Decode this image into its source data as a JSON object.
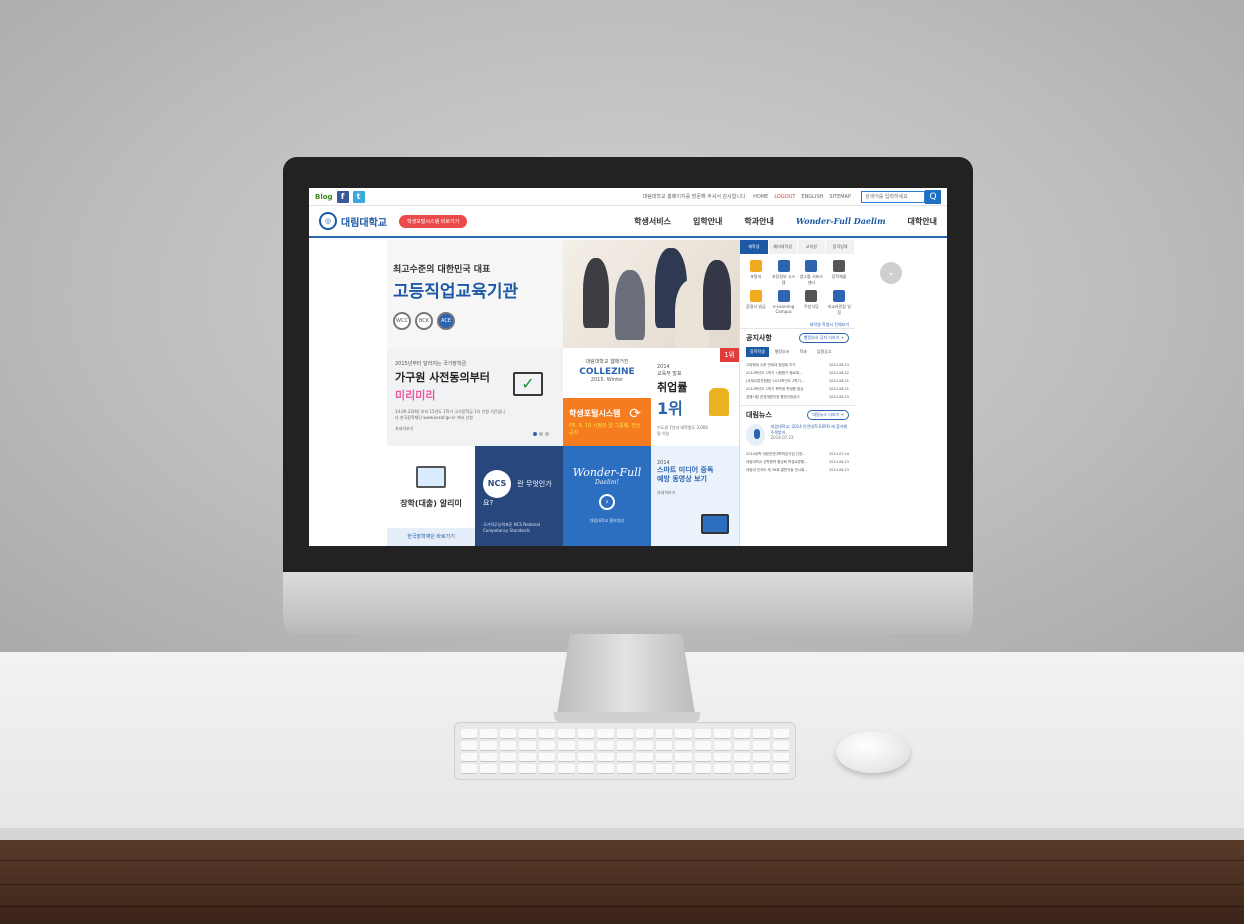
{
  "topbar": {
    "blog_label": "Blog",
    "facebook_icon": "f",
    "twitter_icon": "t",
    "notice_text": "대림대학교 홈페이지를 방문해 주셔서 감사합니다.",
    "links": [
      "HOME",
      "LOGOUT",
      "ENGLISH",
      "SITEMAP"
    ],
    "search_placeholder": "검색어를 입력하세요",
    "search_button": "Q"
  },
  "nav": {
    "logo_text": "대림대학교",
    "portal_button": "학생포털시스템 바로가기",
    "items": [
      "학생서비스",
      "입학안내",
      "학과안내",
      "Wonder-Full Daelim",
      "대학안내"
    ]
  },
  "hero": {
    "subtitle": "최고수준의 대한민국 대표",
    "title": "고등직업교육기관",
    "badges": [
      "WCC",
      "BCK",
      "ACE"
    ]
  },
  "tiles": {
    "scholarship_top": "2015년부터 달라지는 국가장학금",
    "scholarship_main": "가구원 사전동의부터",
    "scholarship_pink": "미리미리",
    "scholarship_small": "14.09.23(화) 부터 15년도 1학기 국가장학금 1차 신청 기간입니다 한국장학재단 www.kosaf.go.kr 에서 신청",
    "more": "자세히보기",
    "collezine_top": "대림대학교 웹매거진",
    "collezine": "COLLEZINE",
    "collezine_sub": "2015. Winter",
    "portal_main": "학생포털시스템",
    "portal_yellow": "E6, 9, 10 시정의 입 그룹웨, 전산공지",
    "rank_tag": "1위",
    "employ_year": "2014",
    "employ_org": "교육부 발표",
    "employ_main": "취업률",
    "employ_rank": "1위",
    "employ_small": "수도권 7년과 대학원도 3,000명 이상",
    "loan_label": "장학(대출) 알리미",
    "kosaf_label": "한국장학재단 바로가기",
    "ncs_circle": "NCS",
    "ncs_question": "란 무엇인가요?",
    "ncs_small": "국가직무능력표준 NCS National Competency Standards",
    "wonder": "Wonder-Full",
    "wonder_sub": "Daelim!",
    "wonder_small": "대림대학교 홍보영상",
    "media_year": "2014",
    "media_title": "스마트 미디어 중독예방 동영상 보기",
    "media_more": "자세히보기"
  },
  "side": {
    "tabs": [
      "재학생",
      "예비대학생",
      "교직원",
      "합격입체"
    ],
    "quick": [
      {
        "label": "포탈지",
        "color": "#f1a91e"
      },
      {
        "label": "포장정보 시스템",
        "color": "#2d64b0"
      },
      {
        "label": "청소틀 서비스센터",
        "color": "#2d64b0"
      },
      {
        "label": "장학제출",
        "color": "#555555"
      },
      {
        "label": "증명서 발급",
        "color": "#f1a91e"
      },
      {
        "label": "e-Learning Campus",
        "color": "#2d64b0"
      },
      {
        "label": "주방식당",
        "color": "#555555"
      },
      {
        "label": "비교과관점 일정",
        "color": "#2d64b0"
      }
    ],
    "quick_more": "재학생 학생서 전체보기",
    "notice_title": "공지사항",
    "notice_more": "행정부서 공지 더보기 +",
    "notice_tabs": [
      "장학학생",
      "행정부서",
      "학과",
      "입찰공고"
    ],
    "notices": [
      {
        "title": "고양형태 수준 연세대 등업채 추가",
        "date": "2014.08.23"
      },
      {
        "title": "2014학년도 2학기 시험평가 종료제...",
        "date": "2014.08.22"
      },
      {
        "title": "[국제교류지원원] 2014학년도 2학기...",
        "date": "2014.08.21"
      },
      {
        "title": "2014학년도 2학기 복학생 학생증 발급",
        "date": "2014.08.21"
      },
      {
        "title": "경쟁시험 운영계원지침 협정이방공고",
        "date": "2014.08.19"
      }
    ],
    "news_title": "대림뉴스",
    "news_more": "대림뉴스 더보기 +",
    "news_feature": "대림대학교, 2014 안전대학 EXPO 에 참가해 주목받아",
    "news_feature_date": "2014.07.23",
    "news": [
      {
        "title": "2014대학 대림연연대학학감사업 선정...",
        "date": "2014.07.04"
      },
      {
        "title": "대림대학교 산학협력 활성화 학생교류활...",
        "date": "2014.06.13"
      },
      {
        "title": "대림대 전국도 제 36회 콜판자동 전시회...",
        "date": "2014.06.13"
      }
    ]
  },
  "scroll_button": "⌄"
}
